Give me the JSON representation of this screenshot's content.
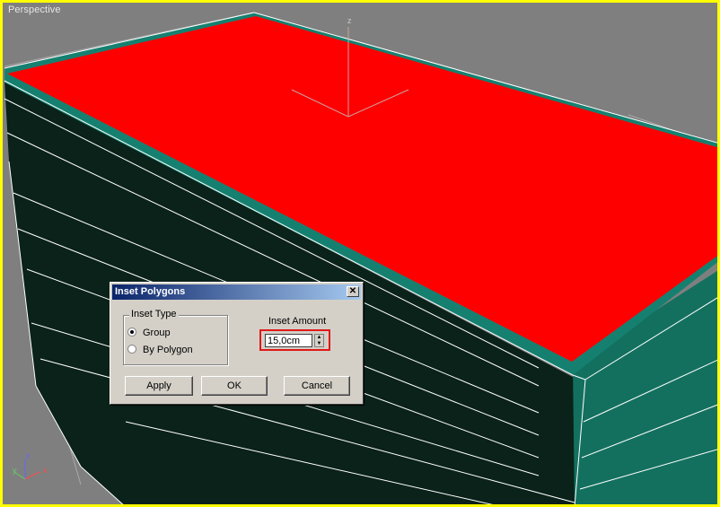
{
  "viewport": {
    "label": "Perspective",
    "axis_labels": {
      "x": "x",
      "y": "y",
      "z": "z"
    },
    "colors": {
      "background": "#7f7f7f",
      "active_border": "#ffff00",
      "selected_face": "#ff0000",
      "side_face": "#0a2219",
      "edge_highlight": "#1a7a6a",
      "wireframe": "#ffffff"
    }
  },
  "dialog": {
    "title": "Inset Polygons",
    "close_symbol": "✕",
    "inset_type": {
      "title": "Inset Type",
      "options": [
        {
          "label": "Group",
          "checked": true
        },
        {
          "label": "By Polygon",
          "checked": false
        }
      ]
    },
    "inset_amount": {
      "label": "Inset Amount",
      "value": "15,0cm",
      "highlight_color": "#e01818"
    },
    "buttons": {
      "apply": "Apply",
      "ok": "OK",
      "cancel": "Cancel"
    }
  }
}
